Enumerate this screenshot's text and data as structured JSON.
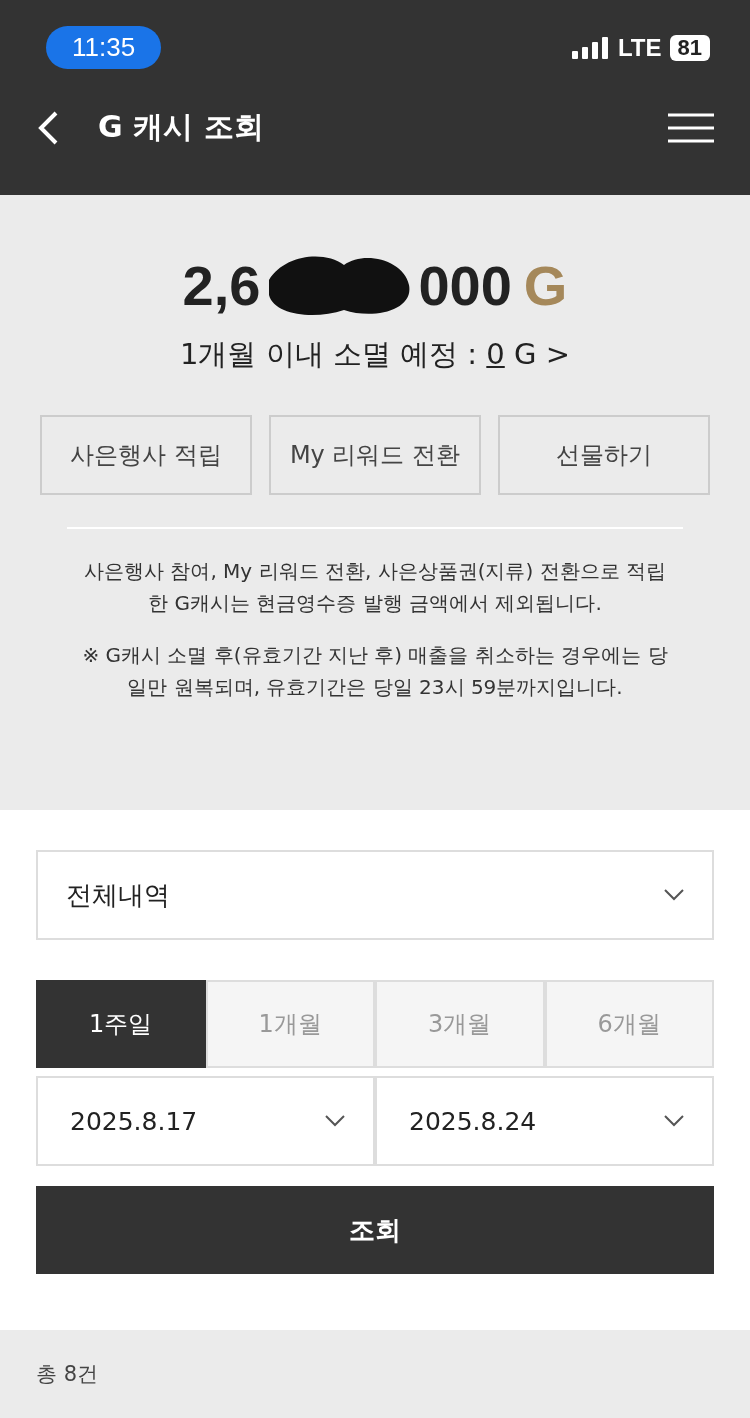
{
  "status_bar": {
    "time": "11:35",
    "network": "LTE",
    "battery": "81"
  },
  "header": {
    "title": "G 캐시 조회"
  },
  "balance": {
    "amount_start": "2,6",
    "amount_end": "000",
    "unit": "G",
    "redacted": true,
    "expiry_label": "1개월 이내 소멸 예정 :",
    "expiry_value": "0",
    "expiry_unit": "G >"
  },
  "actions": [
    "사은행사 적립",
    "My 리워드 전환",
    "선물하기"
  ],
  "notice": "사은행사 참여, My 리워드 전환, 사은상품권(지류) 전환으로 적립한 G캐시는 현금영수증 발행 금액에서 제외됩니다.",
  "warning": "※ G캐시 소멸 후(유효기간 지난 후) 매출을 취소하는 경우에는 당일만 원복되며, 유효기간은 당일 23시 59분까지입니다.",
  "filter": {
    "value": "전체내역"
  },
  "periods": [
    {
      "label": "1주일",
      "selected": true
    },
    {
      "label": "1개월",
      "selected": false
    },
    {
      "label": "3개월",
      "selected": false
    },
    {
      "label": "6개월",
      "selected": false
    }
  ],
  "dates": [
    "2025.8.17",
    "2025.8.24"
  ],
  "search_button": "조회",
  "total": "총 8건"
}
